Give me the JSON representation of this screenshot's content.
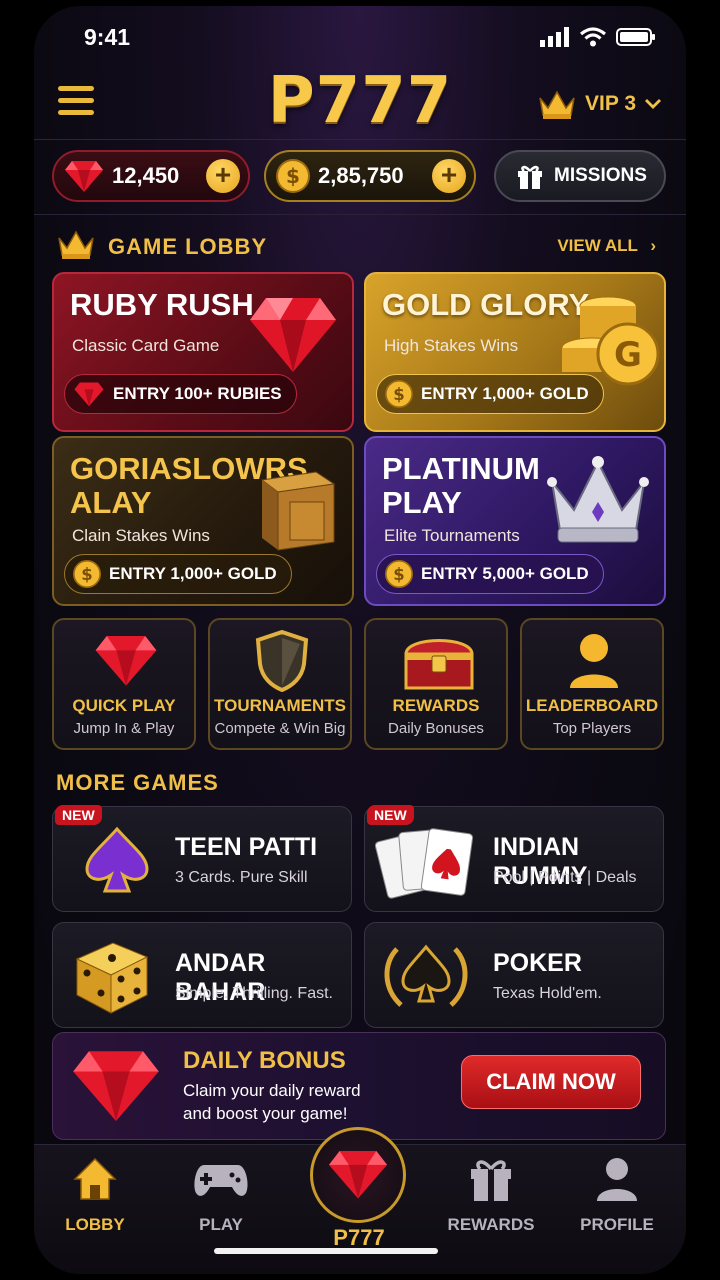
{
  "status_bar": {
    "time": "9:41"
  },
  "header": {
    "logo": "P777",
    "vip_label": "VIP 3"
  },
  "balances": {
    "rubies": "12,450",
    "gold": "2,85,750",
    "missions_label": "MISSIONS"
  },
  "lobby": {
    "title": "GAME LOBBY",
    "view_all": "VIEW ALL",
    "cards": [
      {
        "title": "RUBY RUSH",
        "subtitle": "Classic Card Game",
        "entry": "ENTRY 100+ RUBIES"
      },
      {
        "title": "GOLD GLORY",
        "subtitle": "High Stakes Wins",
        "entry": "ENTRY 1,000+ GOLD"
      },
      {
        "title_line1": "GORIASLOWRS",
        "title_line2": "ALAY",
        "subtitle": "Clain Stakes Wins",
        "entry": "ENTRY 1,000+ GOLD"
      },
      {
        "title_line1": "PLATINUM",
        "title_line2": "PLAY",
        "subtitle": "Elite Tournaments",
        "entry": "ENTRY 5,000+ GOLD"
      }
    ]
  },
  "quick_tiles": [
    {
      "title": "QUICK PLAY",
      "subtitle": "Jump In & Play"
    },
    {
      "title": "TOURNAMENTS",
      "subtitle": "Compete & Win Big"
    },
    {
      "title": "REWARDS",
      "subtitle": "Daily Bonuses"
    },
    {
      "title": "LEADERBOARD",
      "subtitle": "Top Players"
    }
  ],
  "more_games": {
    "title": "MORE GAMES",
    "new_badge": "NEW",
    "items": [
      {
        "title": "TEEN PATTI",
        "subtitle": "3 Cards. Pure Skill"
      },
      {
        "title": "INDIAN RUMMY",
        "subtitle": "Pool | Points | Deals"
      },
      {
        "title": "ANDAR BAHAR",
        "subtitle": "Simple. Thrilling. Fast."
      },
      {
        "title": "POKER",
        "subtitle": "Texas Hold'em."
      }
    ]
  },
  "daily_bonus": {
    "title": "DAILY BONUS",
    "text": "Claim your daily reward and boost your game!",
    "button": "CLAIM NOW"
  },
  "bottom_nav": {
    "items": [
      "LOBBY",
      "PLAY",
      "P777",
      "REWARDS",
      "PROFILE"
    ],
    "active": "LOBBY"
  },
  "colors": {
    "gold": "#f0bf48",
    "ruby": "#c7141f",
    "background": "#0b0912"
  }
}
